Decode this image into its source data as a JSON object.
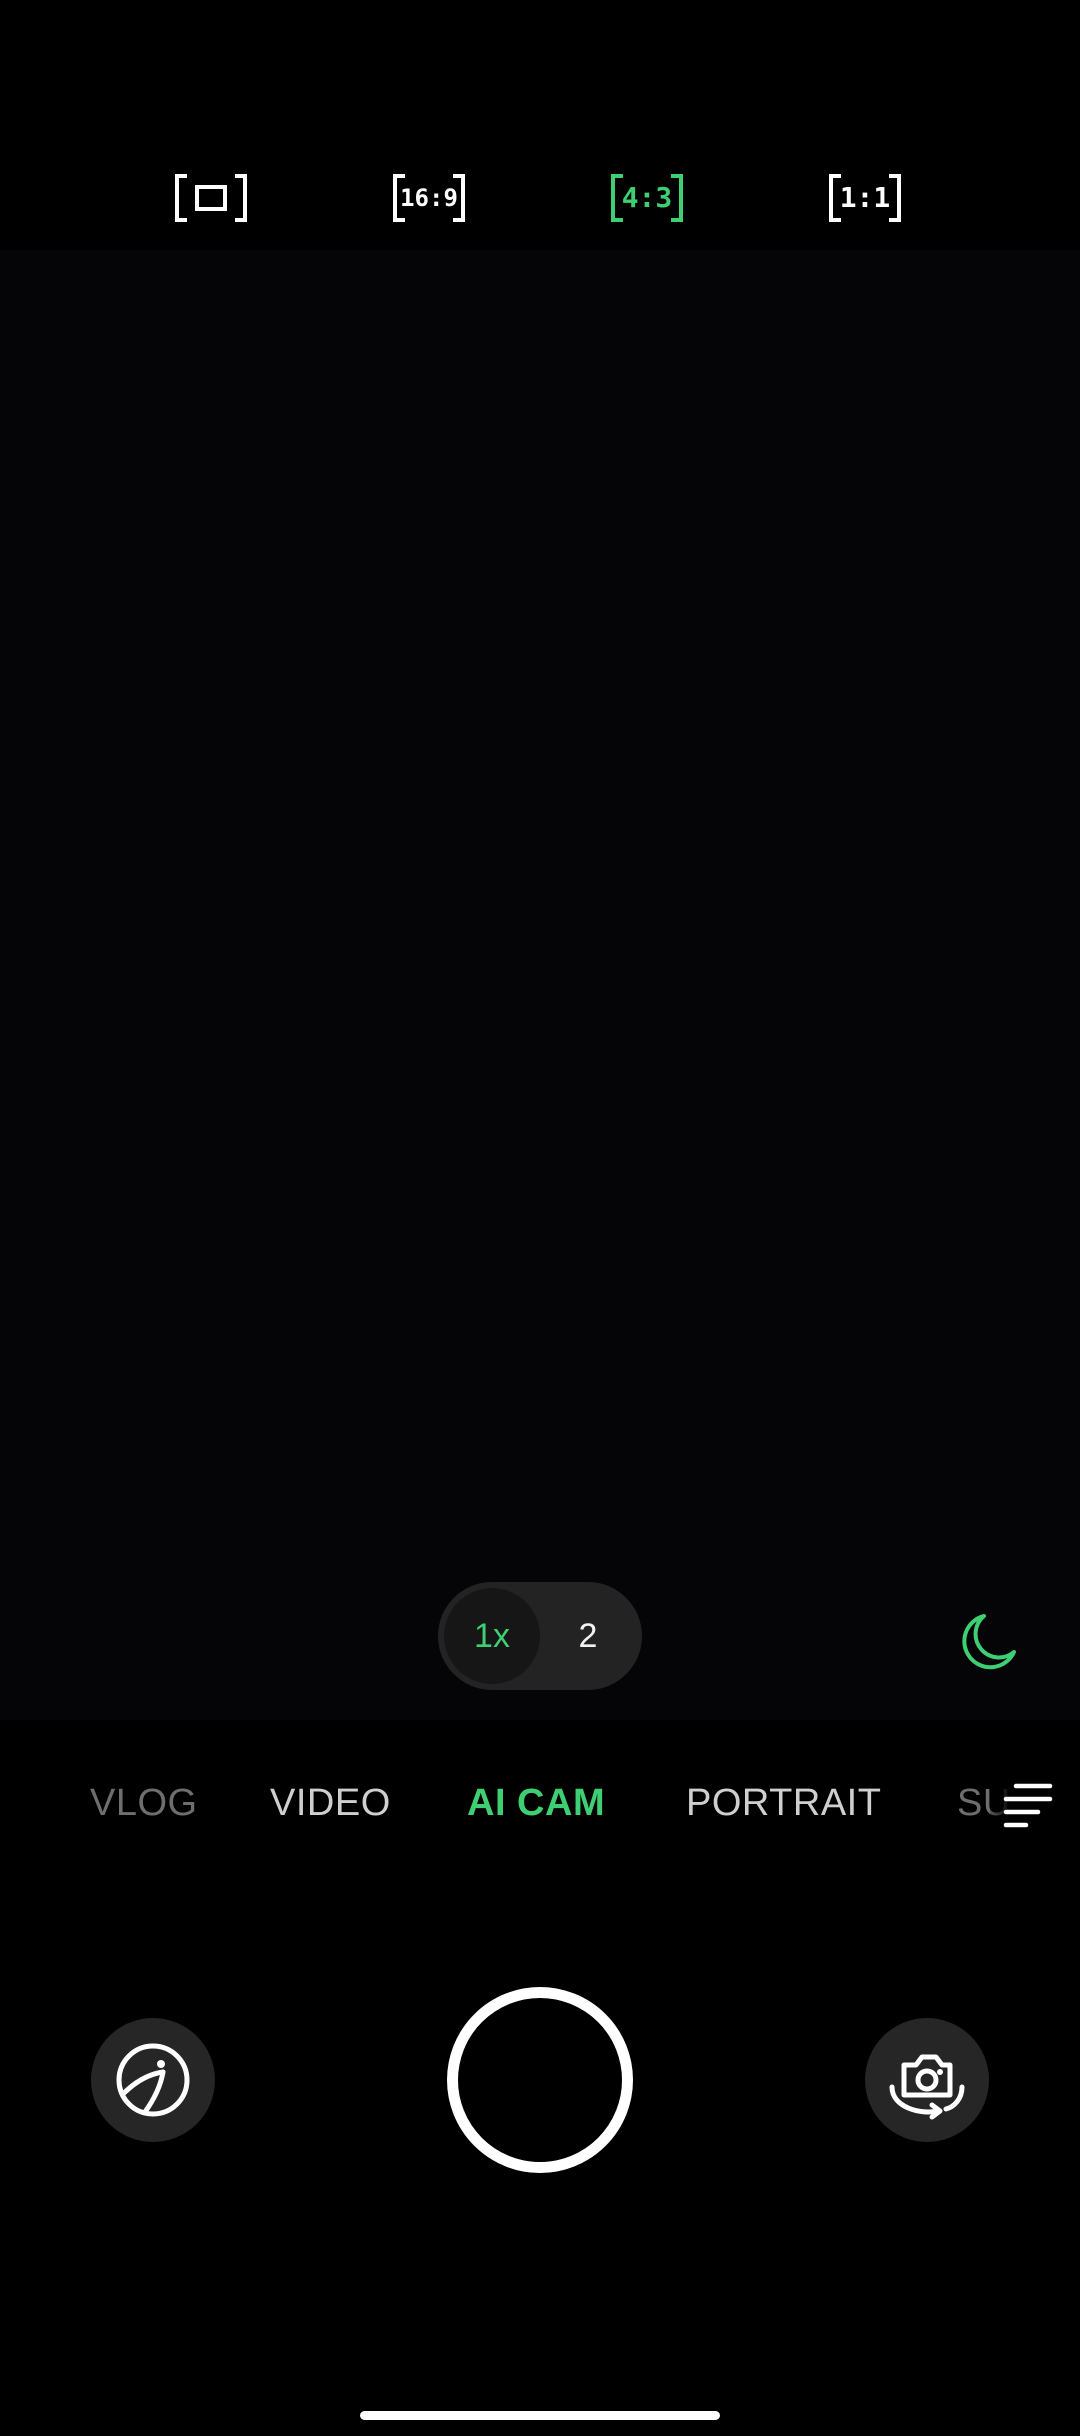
{
  "colors": {
    "accent": "#3ecf72",
    "background": "#000000",
    "viewfinder": "#050407",
    "pill": "#232323",
    "button": "#262626"
  },
  "aspect_ratios": [
    {
      "label": "",
      "icon": "full-frame-icon",
      "selected": false
    },
    {
      "label": "16:9",
      "icon": "aspect-16-9-icon",
      "selected": false
    },
    {
      "label": "4:3",
      "icon": "aspect-4-3-icon",
      "selected": true
    },
    {
      "label": "1:1",
      "icon": "aspect-1-1-icon",
      "selected": false
    }
  ],
  "zoom": {
    "options": [
      "1x",
      "2"
    ],
    "selected": "1x"
  },
  "night_mode": {
    "icon": "moon-icon",
    "active": true
  },
  "modes": {
    "items": [
      "VLOG",
      "VIDEO",
      "AI CAM",
      "PORTRAIT",
      "SU"
    ],
    "selected": "AI CAM"
  },
  "menu": {
    "icon": "menu-lines-icon"
  },
  "bottom_controls": {
    "left_icon": "filter-lens-icon",
    "shutter_icon": "shutter-icon",
    "right_icon": "switch-camera-icon"
  }
}
